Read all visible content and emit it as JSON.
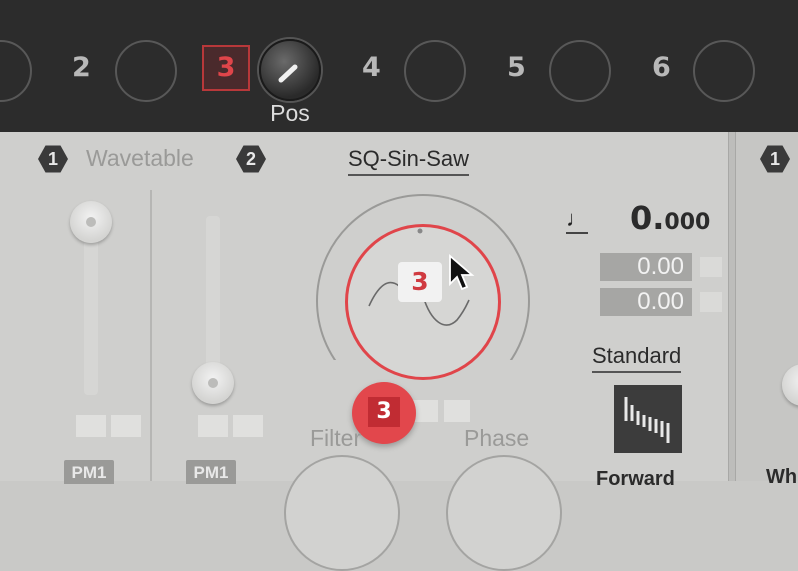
{
  "topbar": {
    "slots": [
      "2",
      "3",
      "4",
      "5",
      "6"
    ],
    "active_slot": "3",
    "knob_label": "Pos"
  },
  "oscillator": {
    "badge_left": "1",
    "badge_right": "2",
    "section_label": "Wavetable",
    "wavetable_name": "SQ-Sin-Saw",
    "center_badge": "3",
    "modulation_badge": "3"
  },
  "right_controls": {
    "note_symbol": "♩",
    "rate_value_int": "0.",
    "rate_value_dec": "000",
    "value_1": "0.00",
    "value_2": "0.00",
    "mode_label": "Standard",
    "direction_label": "Forward"
  },
  "bottom_labels": {
    "filter": "Filter",
    "phase": "Phase",
    "pm_left": "PM1",
    "pm_right": "PM1"
  },
  "right_panel": {
    "badge": "1",
    "partial_label": "Wh"
  },
  "colors": {
    "accent_red": "#e0454a",
    "topbar_bg": "#2c2c2c",
    "panel_bg": "#cfcfcd"
  }
}
